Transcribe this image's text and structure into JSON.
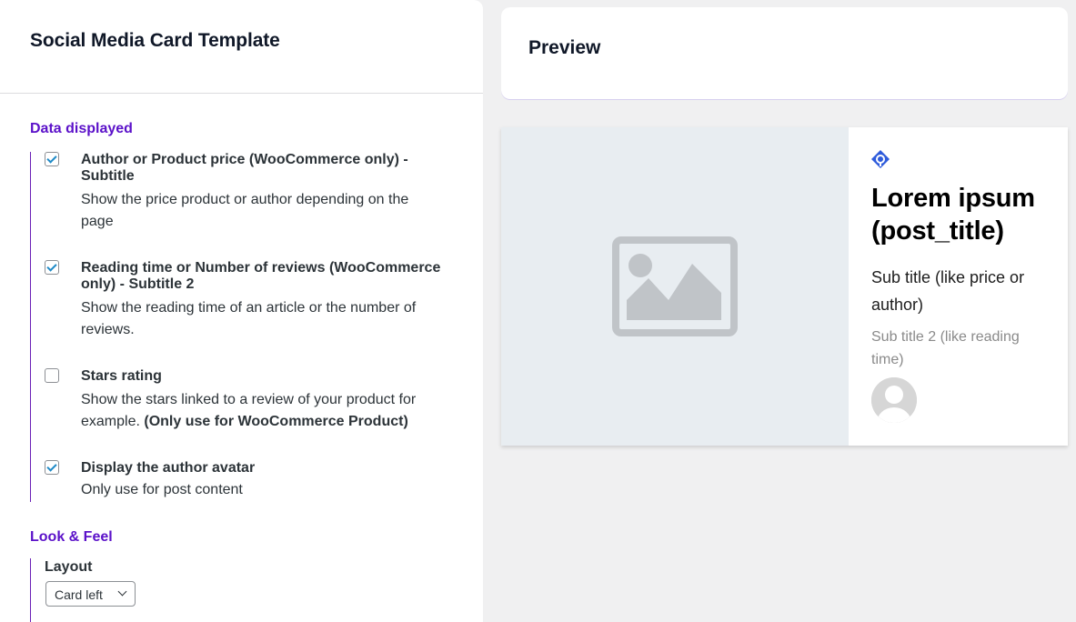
{
  "settings_panel": {
    "title": "Social Media Card Template",
    "data_section": {
      "heading": "Data displayed",
      "options": [
        {
          "title_line1": "Author or Product price (WooCommerce only) -",
          "title_line2": "Subtitle",
          "desc_line1": "Show the price product or author depending on the",
          "desc_line2": "page",
          "checked": true
        },
        {
          "title_line1": "Reading time or Number of reviews (WooCommerce",
          "title_line2": "only) - Subtitle 2",
          "desc_line1": "Show the reading time of an article or the number of",
          "desc_line2": "reviews.",
          "checked": true
        },
        {
          "title_line1": "Stars rating",
          "desc_line1": "Show the stars linked to a review of your product for",
          "desc_line2_plain": "example. ",
          "desc_line2_bold": "(Only use for WooCommerce Product)",
          "checked": false
        },
        {
          "title_line1": "Display the author avatar",
          "desc_line1": "Only use for post content",
          "checked": true
        }
      ]
    },
    "look_section": {
      "heading": "Look & Feel",
      "layout_label": "Layout",
      "layout_value": "Card left"
    }
  },
  "preview": {
    "title": "Preview",
    "card": {
      "title_line1": "Lorem ipsum",
      "title_line2": "(post_title)",
      "subtitle": "Sub title (like price or author)",
      "subtitle2": "Sub title 2 (like reading time)",
      "image_icon": "image-placeholder-icon",
      "logo_icon": "site-logo-icon",
      "avatar_icon": "user-avatar-icon"
    }
  },
  "colors": {
    "accent_purple": "#5b11c9",
    "checkbox_check": "#1f8ac7",
    "logo_blue": "#2e5bdb"
  }
}
